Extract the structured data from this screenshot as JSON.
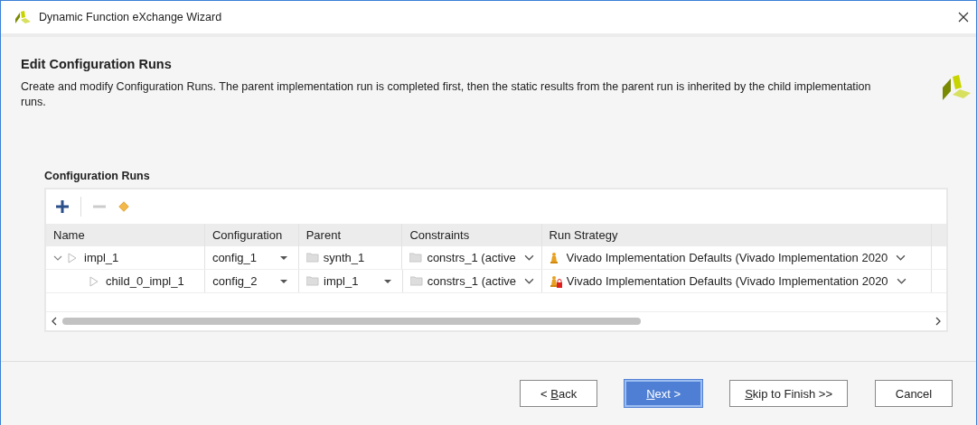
{
  "window": {
    "title": "Dynamic Function eXchange Wizard"
  },
  "header": {
    "title": "Edit Configuration Runs",
    "description": "Create and modify Configuration Runs. The parent implementation run is completed first, then the static results from the parent run is inherited by the child implementation runs."
  },
  "section_title": "Configuration Runs",
  "toolbar": [
    {
      "kind": "add",
      "disabled": false
    },
    {
      "kind": "remove",
      "disabled": true
    },
    {
      "kind": "diamond",
      "disabled": false
    }
  ],
  "table": {
    "columns": [
      "Name",
      "Configuration",
      "Parent",
      "Constraints",
      "Run Strategy"
    ],
    "rows": [
      {
        "name": "impl_1",
        "expanded": true,
        "configuration": "config_1",
        "parent": "synth_1",
        "parent_dropdown": false,
        "constraints": "constrs_1 (active",
        "strategy": "Vivado Implementation Defaults (Vivado Implementation 2020",
        "strategy_locked": false,
        "children": [
          {
            "name": "child_0_impl_1",
            "configuration": "config_2",
            "parent": "impl_1",
            "parent_dropdown": true,
            "constraints": "constrs_1 (active",
            "strategy": "Vivado Implementation Defaults (Vivado Implementation 2020",
            "strategy_locked": true
          }
        ]
      }
    ]
  },
  "buttons": [
    {
      "pre": "< ",
      "key": "B",
      "post": "ack",
      "kind": "default"
    },
    {
      "key": "N",
      "post": "ext >",
      "kind": "primary"
    },
    {
      "key": "S",
      "post": "kip to Finish >>",
      "kind": "default"
    },
    {
      "pre": "Cancel",
      "kind": "cancel"
    }
  ]
}
